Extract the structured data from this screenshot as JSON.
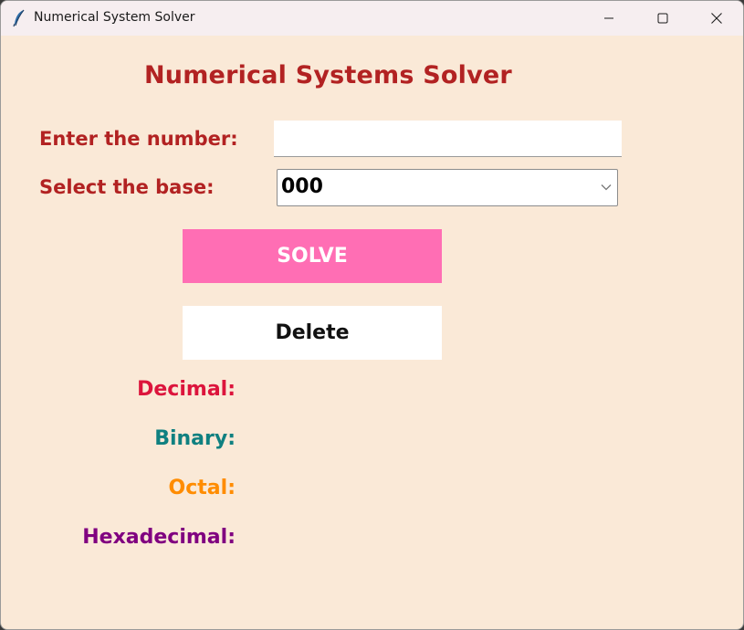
{
  "window": {
    "title": "Numerical System Solver"
  },
  "app": {
    "heading": "Numerical Systems Solver",
    "number_label": "Enter the number:",
    "number_value": "",
    "base_label": "Select the base:",
    "base_selected": "000",
    "solve_label": "SOLVE",
    "delete_label": "Delete"
  },
  "results": {
    "decimal": {
      "label": "Decimal:",
      "color": "#dc143c"
    },
    "binary": {
      "label": "Binary:",
      "color": "#0f8080"
    },
    "octal": {
      "label": "Octal:",
      "color": "#ff8c00"
    },
    "hexadecimal": {
      "label": "Hexadecimal:",
      "color": "#800080"
    }
  },
  "colors": {
    "background": "#fae9d7",
    "accent": "#b22222",
    "solve_button": "#ff6eb4"
  }
}
